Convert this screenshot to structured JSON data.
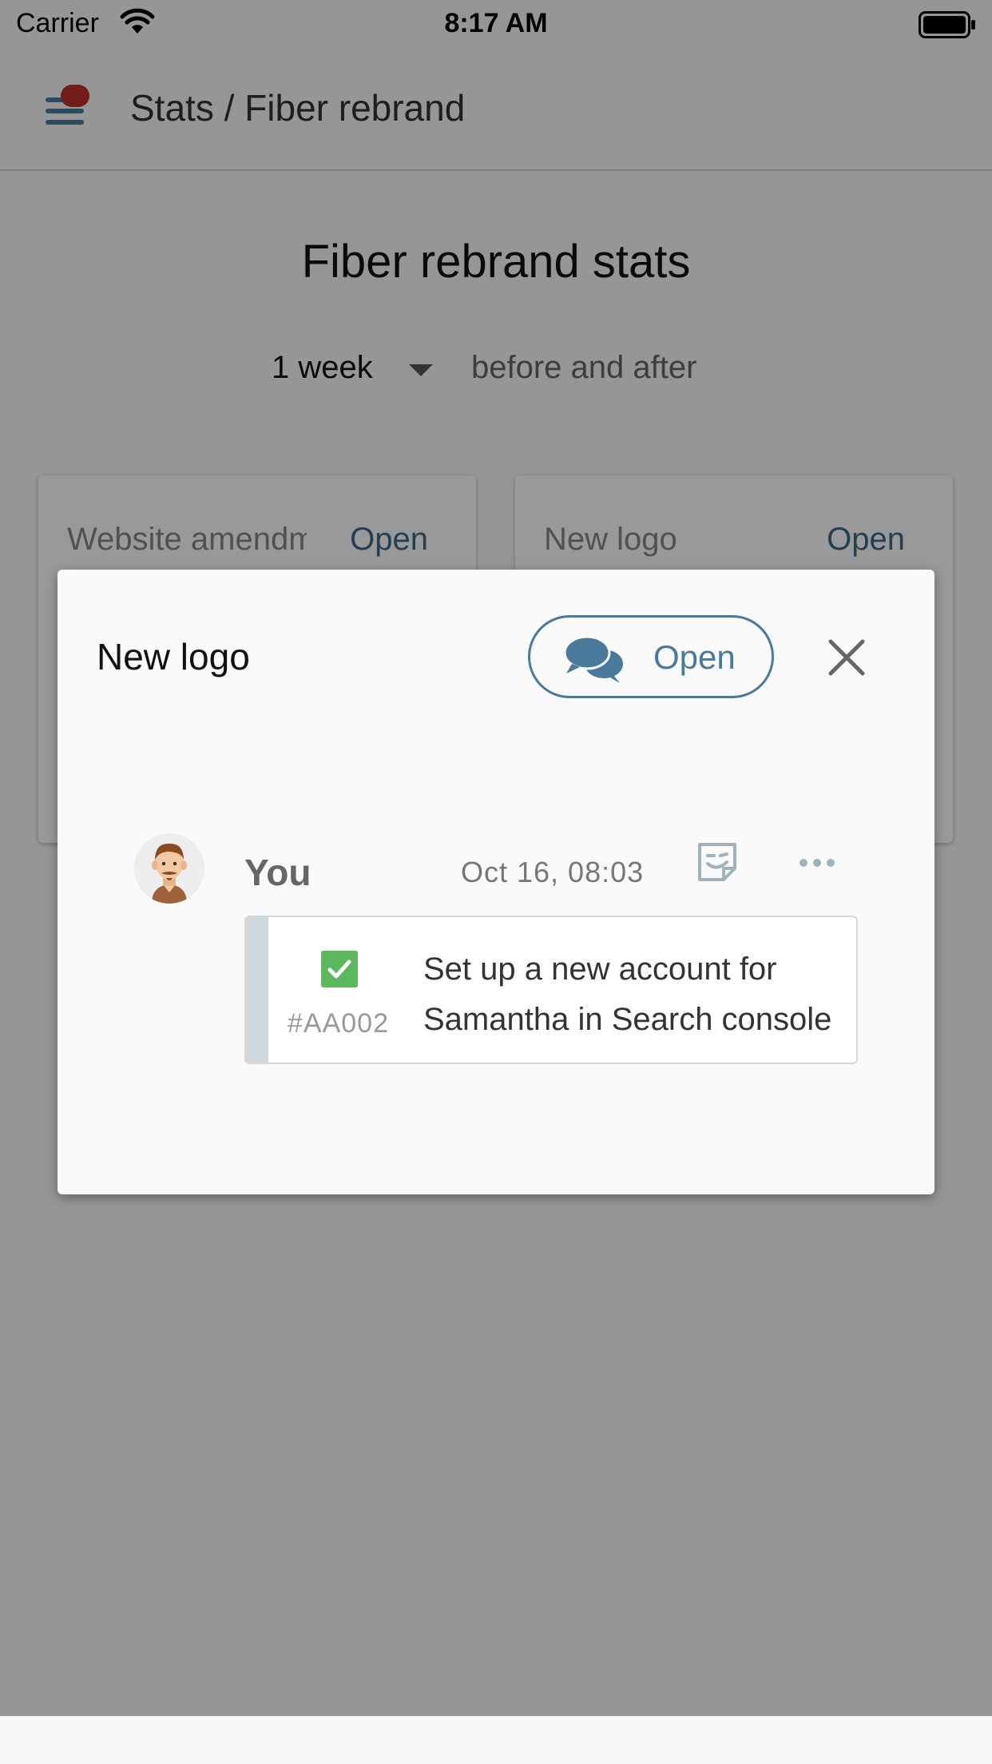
{
  "status_bar": {
    "carrier": "Carrier",
    "time": "8:17 AM"
  },
  "header": {
    "breadcrumb": "Stats / Fiber rebrand"
  },
  "page": {
    "title": "Fiber rebrand stats",
    "range_value": "1 week",
    "range_suffix": "before and after"
  },
  "cards": [
    {
      "title": "Website amendments",
      "open_label": "Open"
    },
    {
      "title": "New logo",
      "open_label": "Open"
    }
  ],
  "dialog": {
    "title": "New logo",
    "open_button_label": "Open",
    "comment": {
      "author": "You",
      "timestamp": "Oct 16, 08:03",
      "task": {
        "id": "#AA002",
        "text": "Set up a new account for Samantha in Search console",
        "completed": true
      }
    }
  },
  "colors": {
    "accent": "#4a7a9b",
    "notification_dot": "#c03030",
    "task_done": "#5cb85c",
    "overlay": "rgba(0,0,0,0.4)"
  },
  "icons": [
    "wifi-icon",
    "battery-icon",
    "menu-icon",
    "chat-bubbles-icon",
    "close-icon",
    "sticker-icon",
    "more-icon",
    "checkbox-checked-icon"
  ]
}
